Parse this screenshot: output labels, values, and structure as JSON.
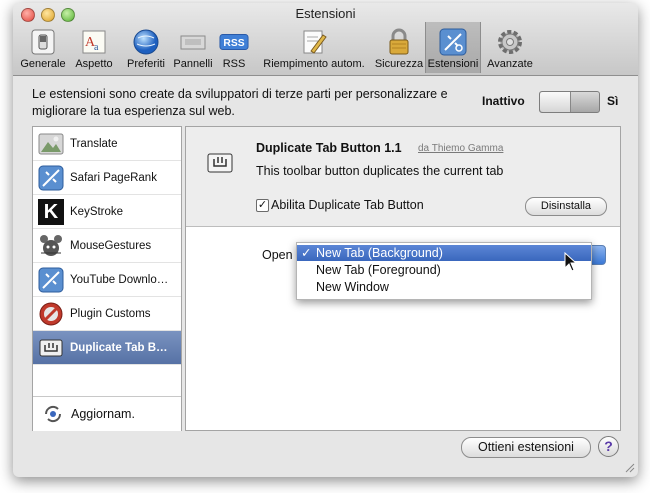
{
  "window": {
    "title": "Estensioni"
  },
  "toolbar": {
    "items": [
      {
        "label": "Generale",
        "icon": "switch-icon"
      },
      {
        "label": "Aspetto",
        "icon": "font-icon"
      },
      {
        "label": "Preferiti",
        "icon": "globe-icon"
      },
      {
        "label": "Pannelli",
        "icon": "tabs-icon"
      },
      {
        "label": "RSS",
        "icon": "rss-icon"
      },
      {
        "label": "Riempimento autom.",
        "icon": "pencil-icon"
      },
      {
        "label": "Sicurezza",
        "icon": "lock-icon"
      },
      {
        "label": "Estensioni",
        "icon": "extensions-icon"
      },
      {
        "label": "Avanzate",
        "icon": "gear-icon"
      }
    ],
    "selected": "Estensioni",
    "rss_badge": "RSS"
  },
  "intro": {
    "text": "Le estensioni sono create da sviluppatori di terze parti per personalizzare e migliorare la tua esperienza sul web.",
    "state_off_label": "Inattivo",
    "state_on_label": "Sì"
  },
  "sidebar": {
    "items": [
      {
        "label": "Translate",
        "icon": "translate-icon"
      },
      {
        "label": "Safari PageRank",
        "icon": "pagerank-icon"
      },
      {
        "label": "KeyStroke",
        "icon": "keystroke-icon"
      },
      {
        "label": "MouseGestures",
        "icon": "mousegestures-icon"
      },
      {
        "label": "YouTube Downlo…",
        "icon": "youtube-downloader-icon"
      },
      {
        "label": "Plugin Customs",
        "icon": "plugin-customs-icon"
      },
      {
        "label": "Duplicate Tab B…",
        "icon": "duplicate-tab-icon"
      }
    ],
    "selected_index": 6,
    "updates_label": "Aggiornam.",
    "keystroke_letter": "K"
  },
  "detail": {
    "name": "Duplicate Tab Button 1.1",
    "author": "da Thiemo Gamma",
    "description": "This toolbar button duplicates the current tab",
    "enable_label": "Abilita Duplicate Tab Button",
    "enable_checked": true,
    "checkmark": "✓",
    "uninstall_label": "Disinstalla",
    "open_in_label": "Open in",
    "dropdown": {
      "options": [
        "New Tab (Background)",
        "New Tab (Foreground)",
        "New Window"
      ],
      "selected": "New Tab (Background)",
      "check_glyph": "✓"
    }
  },
  "footer": {
    "get_extensions_label": "Ottieni estensioni",
    "help_label": "?"
  },
  "colors": {
    "selection": "#5672a5",
    "menu_highlight": "#3a67bd",
    "help": "#5a3aa8"
  }
}
